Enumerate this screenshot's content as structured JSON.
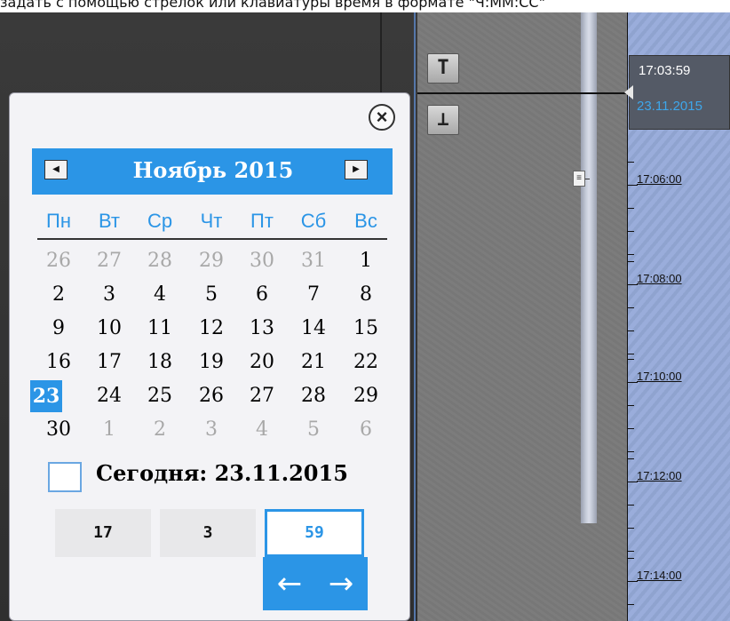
{
  "caption": "задать с помощью стрелок или клавиатуры время в формате \"Ч:ММ:СС\"",
  "timeline": {
    "current_time": "17:03:59",
    "current_date": "23.11.2015",
    "ticks": [
      "17:06:00",
      "17:08:00",
      "17:10:00",
      "17:12:00",
      "17:14:00"
    ]
  },
  "calendar": {
    "month_title": "Ноябрь 2015",
    "weekdays": [
      "Пн",
      "Вт",
      "Ср",
      "Чт",
      "Пт",
      "Сб",
      "Вс"
    ],
    "weeks": [
      [
        {
          "d": "26",
          "m": true
        },
        {
          "d": "27",
          "m": true
        },
        {
          "d": "28",
          "m": true
        },
        {
          "d": "29",
          "m": true
        },
        {
          "d": "30",
          "m": true
        },
        {
          "d": "31",
          "m": true
        },
        {
          "d": "1",
          "m": false
        }
      ],
      [
        {
          "d": "2",
          "m": false
        },
        {
          "d": "3",
          "m": false
        },
        {
          "d": "4",
          "m": false
        },
        {
          "d": "5",
          "m": false
        },
        {
          "d": "6",
          "m": false
        },
        {
          "d": "7",
          "m": false
        },
        {
          "d": "8",
          "m": false
        }
      ],
      [
        {
          "d": "9",
          "m": false
        },
        {
          "d": "10",
          "m": false
        },
        {
          "d": "11",
          "m": false
        },
        {
          "d": "12",
          "m": false
        },
        {
          "d": "13",
          "m": false
        },
        {
          "d": "14",
          "m": false
        },
        {
          "d": "15",
          "m": false
        }
      ],
      [
        {
          "d": "16",
          "m": false
        },
        {
          "d": "17",
          "m": false
        },
        {
          "d": "18",
          "m": false
        },
        {
          "d": "19",
          "m": false
        },
        {
          "d": "20",
          "m": false
        },
        {
          "d": "21",
          "m": false
        },
        {
          "d": "22",
          "m": false
        }
      ],
      [
        {
          "d": "23",
          "m": false,
          "sel": true
        },
        {
          "d": "24",
          "m": false
        },
        {
          "d": "25",
          "m": false
        },
        {
          "d": "26",
          "m": false
        },
        {
          "d": "27",
          "m": false
        },
        {
          "d": "28",
          "m": false
        },
        {
          "d": "29",
          "m": false
        }
      ],
      [
        {
          "d": "30",
          "m": false
        },
        {
          "d": "1",
          "m": true
        },
        {
          "d": "2",
          "m": true
        },
        {
          "d": "3",
          "m": true
        },
        {
          "d": "4",
          "m": true
        },
        {
          "d": "5",
          "m": true
        },
        {
          "d": "6",
          "m": true
        }
      ]
    ],
    "today_label": "Сегодня: 23.11.2015",
    "time": {
      "hours": "17",
      "minutes": "3",
      "seconds": "59"
    },
    "close_glyph": "×",
    "prev_glyph": "◀",
    "next_glyph": "▶",
    "left_arrow_glyph": "←",
    "right_arrow_glyph": "→"
  },
  "toolbar": {
    "top_glyph": "T",
    "bottom_glyph": "⊥"
  },
  "colors": {
    "accent": "#2b95e6",
    "timeline_blue": "#97a9d6",
    "timeline_gray": "#787878"
  }
}
